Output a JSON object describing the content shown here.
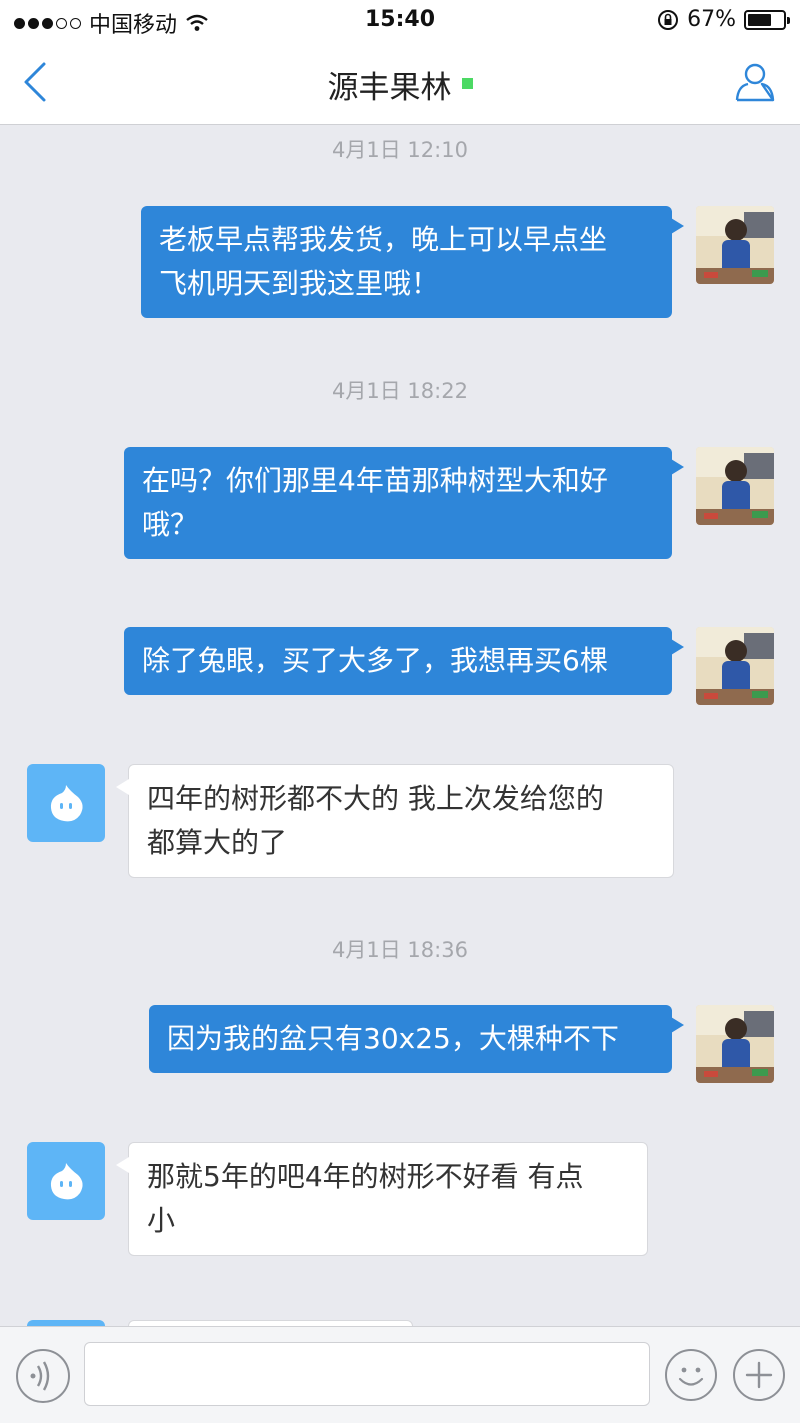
{
  "status_bar": {
    "carrier": "中国移动",
    "time": "15:40",
    "battery": "67%",
    "battery_level": 0.67
  },
  "nav": {
    "title": "源丰果林"
  },
  "messages": [
    {
      "type": "timestamp",
      "text": "4月1日 12:10"
    },
    {
      "type": "outgoing",
      "lines": [
        "老板早点帮我发货，晚上可以早点坐",
        "飞机明天到我这里哦！"
      ]
    },
    {
      "type": "timestamp",
      "text": "4月1日 18:22"
    },
    {
      "type": "outgoing",
      "lines": [
        "在吗？你们那里4年苗那种树型大和好",
        "哦？"
      ]
    },
    {
      "type": "outgoing",
      "lines": [
        "除了兔眼，买了大多了，我想再买6棵"
      ]
    },
    {
      "type": "incoming",
      "lines": [
        "四年的树形都不大的  我上次发给您的",
        "都算大的了"
      ]
    },
    {
      "type": "timestamp",
      "text": "4月1日 18:36"
    },
    {
      "type": "outgoing",
      "lines": [
        "因为我的盆只有30x25，大棵种不下"
      ]
    },
    {
      "type": "incoming",
      "lines": [
        "那就5年的吧4年的树形不好看  有点",
        "小"
      ]
    }
  ],
  "input": {
    "placeholder": ""
  },
  "icons": {
    "back": "chevron-left-icon",
    "profile": "person-icon",
    "voice": "voice-icon",
    "emoji": "smiley-icon",
    "plus": "plus-icon",
    "shop_avatar": "chat-drop-icon"
  },
  "colors": {
    "accent": "#2e86d9",
    "online": "#4cd964",
    "shop_avatar": "#5eb5f6"
  }
}
